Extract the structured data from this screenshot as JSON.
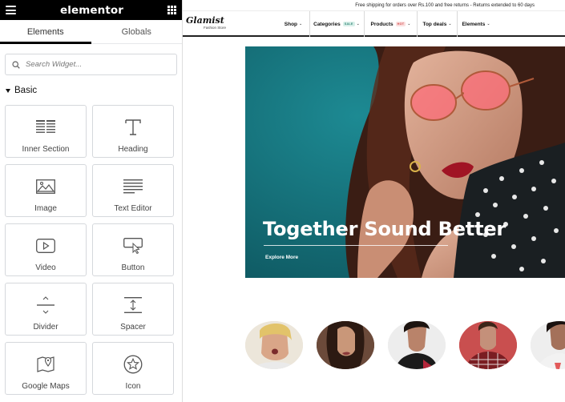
{
  "panel": {
    "title": "elementor",
    "tabs": [
      {
        "label": "Elements"
      },
      {
        "label": "Globals"
      }
    ],
    "search_placeholder": "Search Widget...",
    "section": "Basic",
    "widgets": [
      {
        "label": "Inner Section",
        "icon": "inner-section-icon"
      },
      {
        "label": "Heading",
        "icon": "heading-icon"
      },
      {
        "label": "Image",
        "icon": "image-icon"
      },
      {
        "label": "Text Editor",
        "icon": "text-editor-icon"
      },
      {
        "label": "Video",
        "icon": "video-icon"
      },
      {
        "label": "Button",
        "icon": "button-icon"
      },
      {
        "label": "Divider",
        "icon": "divider-icon"
      },
      {
        "label": "Spacer",
        "icon": "spacer-icon"
      },
      {
        "label": "Google Maps",
        "icon": "google-maps-icon"
      },
      {
        "label": "Icon",
        "icon": "star-icon"
      }
    ]
  },
  "site": {
    "announcement": "Free shipping for orders over Rs.100 and free returns - Returns extended to 60 days",
    "logo": {
      "name": "Glamist",
      "tagline": "Fashion Store"
    },
    "nav": [
      {
        "label": "Shop",
        "badge": ""
      },
      {
        "label": "Categories",
        "badge": "SALE"
      },
      {
        "label": "Products",
        "badge": "HOT"
      },
      {
        "label": "Top deals",
        "badge": ""
      },
      {
        "label": "Elements",
        "badge": ""
      }
    ],
    "hero": {
      "title": "Together Sound Better",
      "link": "Explore More"
    }
  },
  "colors": {
    "accent": "#000000",
    "hero_bg": "#17727c",
    "sale_badge": "#d8efe9",
    "hot_badge": "#fbe0e0"
  }
}
